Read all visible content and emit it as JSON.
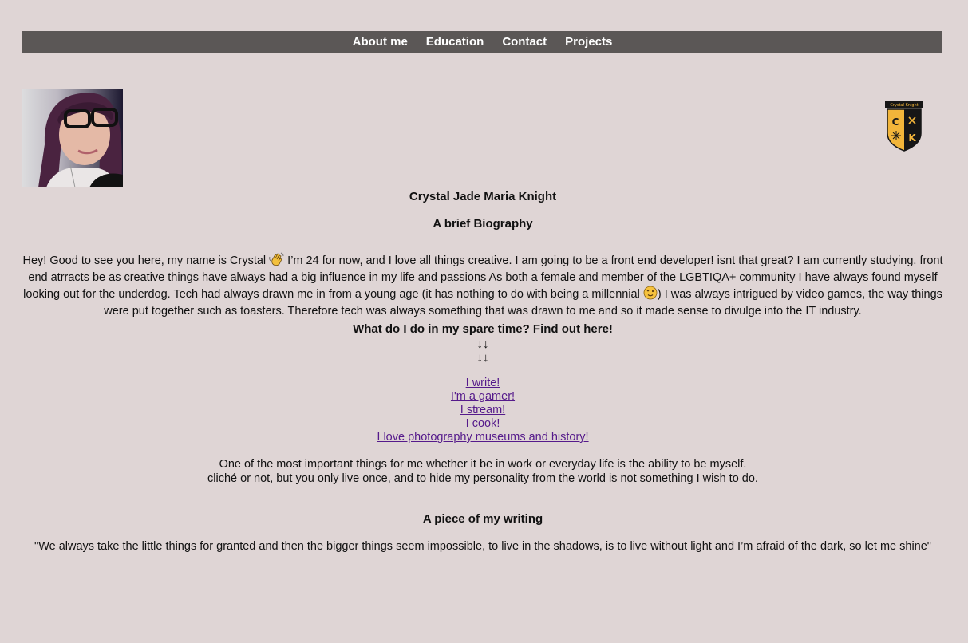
{
  "nav": {
    "items": [
      "About me",
      "Education",
      "Contact",
      "Projects"
    ]
  },
  "logo": {
    "banner_text": "Crystal Knight",
    "letters": [
      "C",
      "K"
    ],
    "colors": {
      "gold": "#f2b53a",
      "black": "#161616"
    }
  },
  "header": {
    "name": "Crystal Jade Maria Knight",
    "subtitle": "A brief Biography"
  },
  "bio": {
    "part1": "Hey! Good to see you here, my name is Crystal ",
    "part2": " I’m 24 for now, and I love all things creative. I am going to be a front end developer! isnt that great? I am currently studying. front end atrracts be as creative things have always had a big influence in my life and passions As both a female and member of the LGBTIQA+ community I have always found myself looking out for the underdog. Tech had always drawn me in from a young age (it has nothing to do with being a millennial ",
    "part3": ") I was always intrigued by video games, the way things were put together such as toasters. Therefore tech was always something that was drawn to me and so it made sense to divulge into the IT industry.",
    "icons": [
      "waving-hand-icon",
      "winking-face-icon"
    ]
  },
  "spare_time": {
    "title": "What do I do in my spare time? Find out here!",
    "arrows": [
      "↓↓",
      "↓↓"
    ],
    "links": [
      "I write!",
      "I'm a gamer!",
      "I stream!",
      "I cook!",
      "I love photography museums and history!"
    ],
    "link_color": "#551a8b"
  },
  "identity": {
    "line1": "One of the most important things for me whether it be in work or everyday life is the ability to be myself.",
    "line2": "cliché or not, but you only live once, and to hide my personality from the world is not something I wish to do."
  },
  "writing": {
    "title": "A piece of my writing",
    "quote": "\"We always take the little things for granted and then the bigger things seem impossible, to live in the shadows, is to live without light and I’m afraid of the dark, so let me shine\""
  },
  "colors": {
    "page_background": "#dfd5d5",
    "nav_background": "#5b5756",
    "nav_text": "#ffffff"
  }
}
